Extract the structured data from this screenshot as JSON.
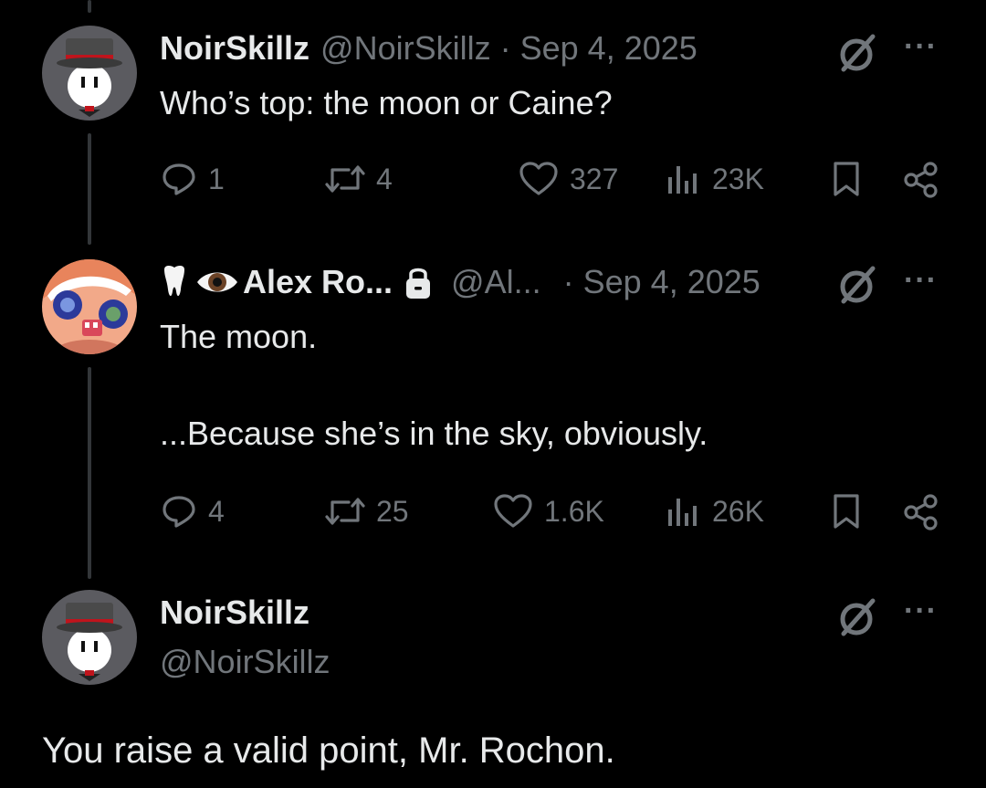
{
  "colors": {
    "background": "#000000",
    "text": "#e7e9ea",
    "muted": "#71767b",
    "thread_line": "#333639"
  },
  "posts": [
    {
      "display_name": "NoirSkillz",
      "handle": "@NoirSkillz",
      "separator": "·",
      "date": "Sep 4, 2025",
      "text": "Who’s top: the moon or Caine?",
      "metrics": {
        "replies": "1",
        "reposts": "4",
        "likes": "327",
        "views": "23K"
      },
      "icons": [
        "grok-icon",
        "more-icon",
        "reply-icon",
        "repost-icon",
        "like-icon",
        "views-icon",
        "bookmark-icon",
        "share-icon"
      ]
    },
    {
      "display_name_prefix_emoji": "🦷 👁",
      "display_name": "Alex Ro...",
      "handle": "@Al...",
      "separator": "·",
      "date": "Sep 4, 2025",
      "text_line1": "The moon.",
      "text_line2": "...Because she’s in the sky, obviously.",
      "metrics": {
        "replies": "4",
        "reposts": "25",
        "likes": "1.6K",
        "views": "26K"
      },
      "icons": [
        "tooth-emoji",
        "eye-emoji",
        "lock-icon",
        "grok-icon",
        "more-icon"
      ]
    },
    {
      "display_name": "NoirSkillz",
      "handle": "@NoirSkillz",
      "text": "You raise a valid point, Mr. Rochon.",
      "icons": [
        "grok-icon",
        "more-icon"
      ]
    }
  ],
  "more_label": "···"
}
